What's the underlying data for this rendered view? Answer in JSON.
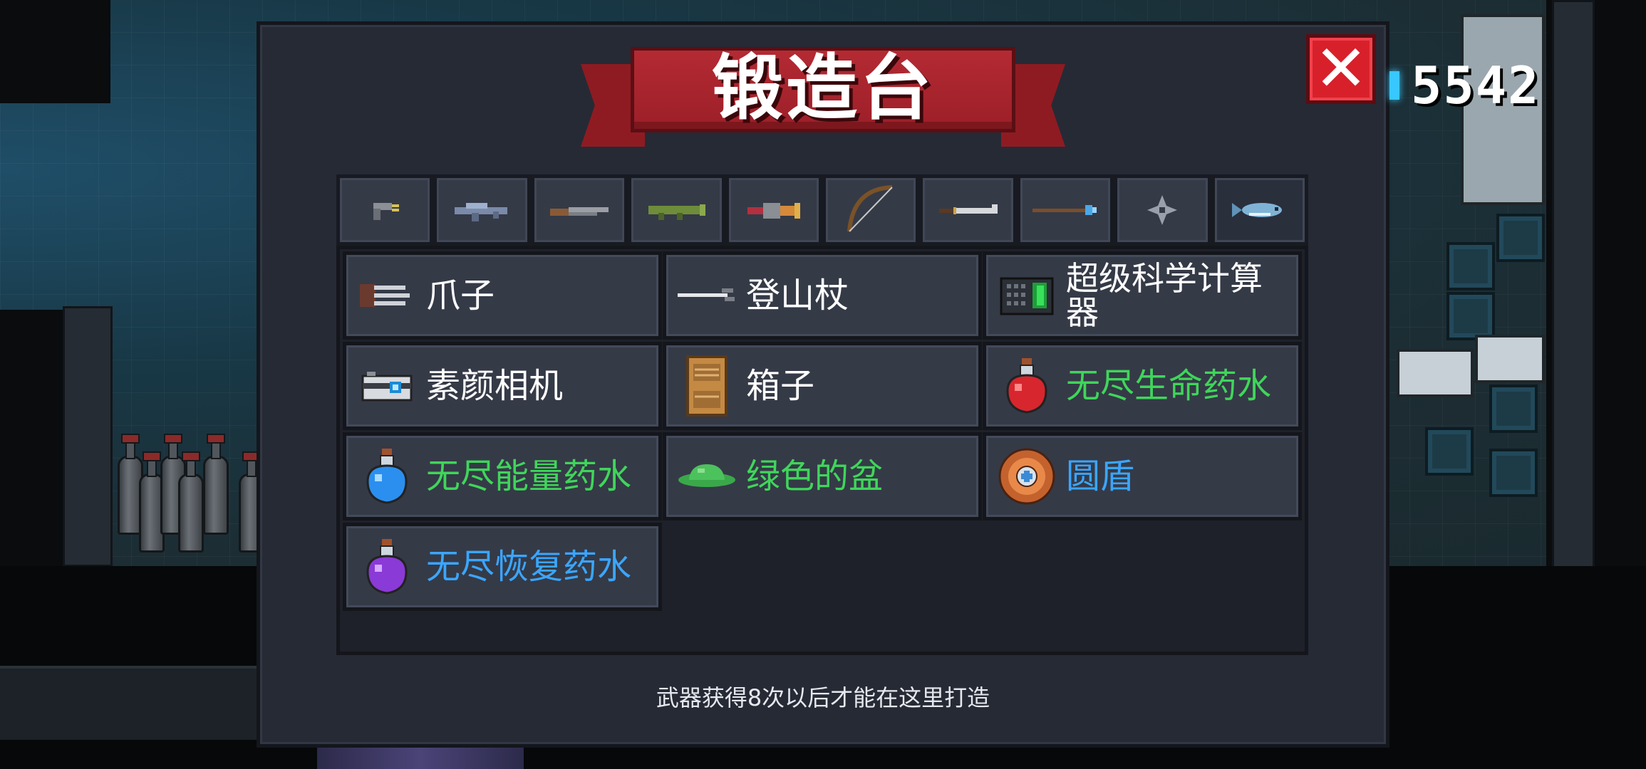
{
  "header": {
    "title": "锻造台"
  },
  "currency": {
    "value": "5542",
    "icon": "gem-icon"
  },
  "close_button": {
    "icon": "close-x-icon",
    "label": "✕"
  },
  "weapon_tabs": [
    {
      "icon": "pistol-icon",
      "active": false
    },
    {
      "icon": "rifle-icon",
      "active": false
    },
    {
      "icon": "shotgun-icon",
      "active": false
    },
    {
      "icon": "rocket-launcher-icon",
      "active": false
    },
    {
      "icon": "flamethrower-icon",
      "active": false
    },
    {
      "icon": "bow-icon",
      "active": false
    },
    {
      "icon": "sword-icon",
      "active": false
    },
    {
      "icon": "staff-icon",
      "active": false
    },
    {
      "icon": "shuriken-icon",
      "active": false
    },
    {
      "icon": "fish-icon",
      "active": true
    }
  ],
  "items": [
    {
      "label": "爪子",
      "icon": "claw-icon",
      "color": "#ffffff"
    },
    {
      "label": "登山杖",
      "icon": "trekking-pole-icon",
      "color": "#ffffff"
    },
    {
      "label": "超级科学计算器",
      "icon": "calculator-icon",
      "color": "#ffffff"
    },
    {
      "label": "素颜相机",
      "icon": "camera-icon",
      "color": "#ffffff"
    },
    {
      "label": "箱子",
      "icon": "box-icon",
      "color": "#ffffff"
    },
    {
      "label": "无尽生命药水",
      "icon": "red-potion-icon",
      "color": "#3fd65a"
    },
    {
      "label": "无尽能量药水",
      "icon": "blue-potion-icon",
      "color": "#3fd65a"
    },
    {
      "label": "绿色的盆",
      "icon": "green-basin-icon",
      "color": "#3fd65a"
    },
    {
      "label": "圆盾",
      "icon": "round-shield-icon",
      "color": "#3aa6ff"
    },
    {
      "label": "无尽恢复药水",
      "icon": "purple-potion-icon",
      "color": "#3aa6ff"
    }
  ],
  "hint": {
    "text": "武器获得8次以后才能在这里打造"
  },
  "colors": {
    "panel": "#262a35",
    "banner": "#a8252e",
    "close": "#d8202b",
    "green_text": "#3fd65a",
    "blue_text": "#3aa6ff"
  }
}
